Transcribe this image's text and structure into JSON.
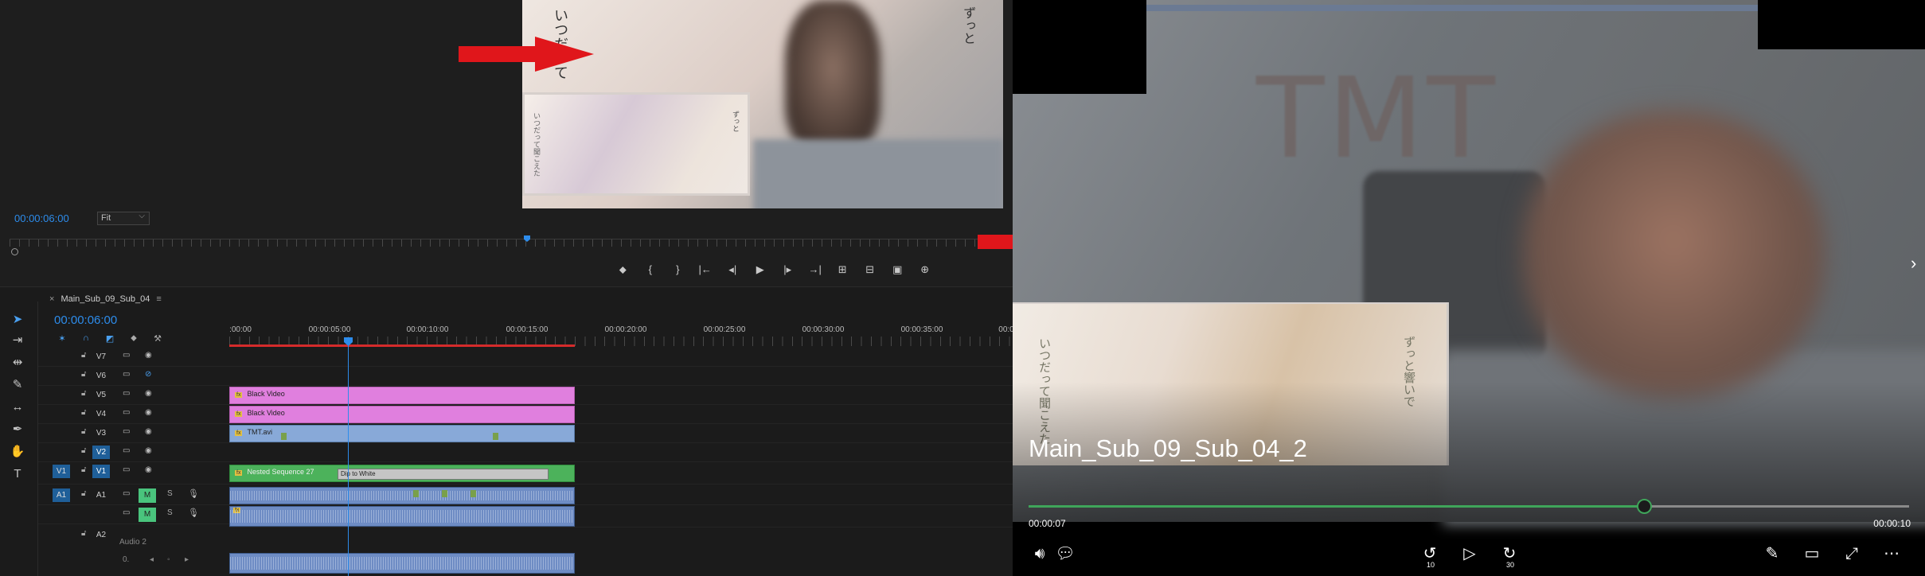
{
  "premiere": {
    "program_monitor": {
      "timecode": "00:00:06:00",
      "zoom": "Fit",
      "jp_text_1": "いつだって",
      "jp_text_2": "ずっと",
      "jp_inset_1": "いつだって聞こえた",
      "jp_inset_2": "ずっと"
    },
    "transport_buttons": [
      "marker-icon",
      "mark-in-icon",
      "mark-out-icon",
      "go-to-in-icon",
      "step-back-icon",
      "play-icon",
      "step-forward-icon",
      "go-to-out-icon",
      "insert-icon",
      "overwrite-icon",
      "export-frame-icon",
      "button-editor-icon"
    ],
    "timeline": {
      "sequence_name": "Main_Sub_09_Sub_04",
      "close_glyph": "×",
      "menu_glyph": "≡",
      "timecode": "00:00:06:00",
      "ruler": [
        ":00:00",
        "00:00:05:00",
        "00:00:10:00",
        "00:00:15:00",
        "00:00:20:00",
        "00:00:25:00",
        "00:00:30:00",
        "00:00:35:00",
        "00:0"
      ],
      "tracks": [
        {
          "name": "V7",
          "src": "",
          "type": "video"
        },
        {
          "name": "V6",
          "src": "",
          "type": "video"
        },
        {
          "name": "V5",
          "src": "",
          "type": "video"
        },
        {
          "name": "V4",
          "src": "",
          "type": "video"
        },
        {
          "name": "V3",
          "src": "",
          "type": "video"
        },
        {
          "name": "V2",
          "src": "",
          "type": "video"
        },
        {
          "name": "V1",
          "src": "V1",
          "type": "video"
        },
        {
          "name": "A1",
          "src": "A1",
          "type": "audio"
        },
        {
          "name": "",
          "src": "",
          "type": "audio"
        },
        {
          "name": "A2",
          "src": "",
          "type": "audio"
        }
      ],
      "audio2_label": "Audio 2",
      "audio2_volume": "0.",
      "mute_label": "M",
      "solo_label": "S",
      "clips": {
        "v5": "Black Video",
        "v4": "Black Video",
        "v3": "TMT.avi",
        "v1": "Nested Sequence 27",
        "v1_transition": "Dip to White"
      },
      "fx_badge": "fx"
    }
  },
  "player": {
    "title": "Main_Sub_09_Sub_04_2",
    "current_time": "00:00:07",
    "total_time": "00:00:10",
    "progress": 0.7,
    "overlay_text": "TMT",
    "jp_inset_1": "いつだって聞こえた",
    "jp_inset_2": "ずっと響いで",
    "skip_back": "10",
    "skip_forward": "30",
    "accent": "#3fa55a"
  },
  "colors": {
    "premiere_accent": "#2d8ceb",
    "arrow": "#e0161b"
  }
}
